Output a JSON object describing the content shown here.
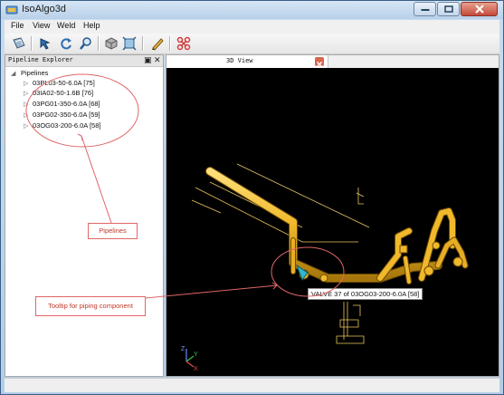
{
  "app": {
    "title": "IsoAlgo3d"
  },
  "menu": [
    "File",
    "View",
    "Weld",
    "Help"
  ],
  "toolbar": {
    "icons": [
      "open-file-icon",
      "pan-icon",
      "rotate-icon",
      "zoom-icon",
      "view-cube-icon",
      "fit-view-icon",
      "pencil-icon",
      "hide-icon"
    ]
  },
  "explorer": {
    "title": "Pipeline Explorer",
    "root_label": "Pipelines",
    "items": [
      "03PL03-50-6.0A [75]",
      "03IA02-50-1.6B [76]",
      "03PG01-350-6.0A [68]",
      "03PG02-350-6.0A [59]",
      "03OG03-200-6.0A [58]"
    ]
  },
  "view": {
    "tab_label": "3D View",
    "tooltip": "VALVE 37 of 03OG03-200-6.0A [58]",
    "axis": {
      "z": "Z",
      "y": "Y",
      "x": "X"
    }
  },
  "annotations": {
    "pipelines_label": "Pipelines",
    "tooltip_label": "Tooltip for piping component",
    "color": "#e06666"
  }
}
